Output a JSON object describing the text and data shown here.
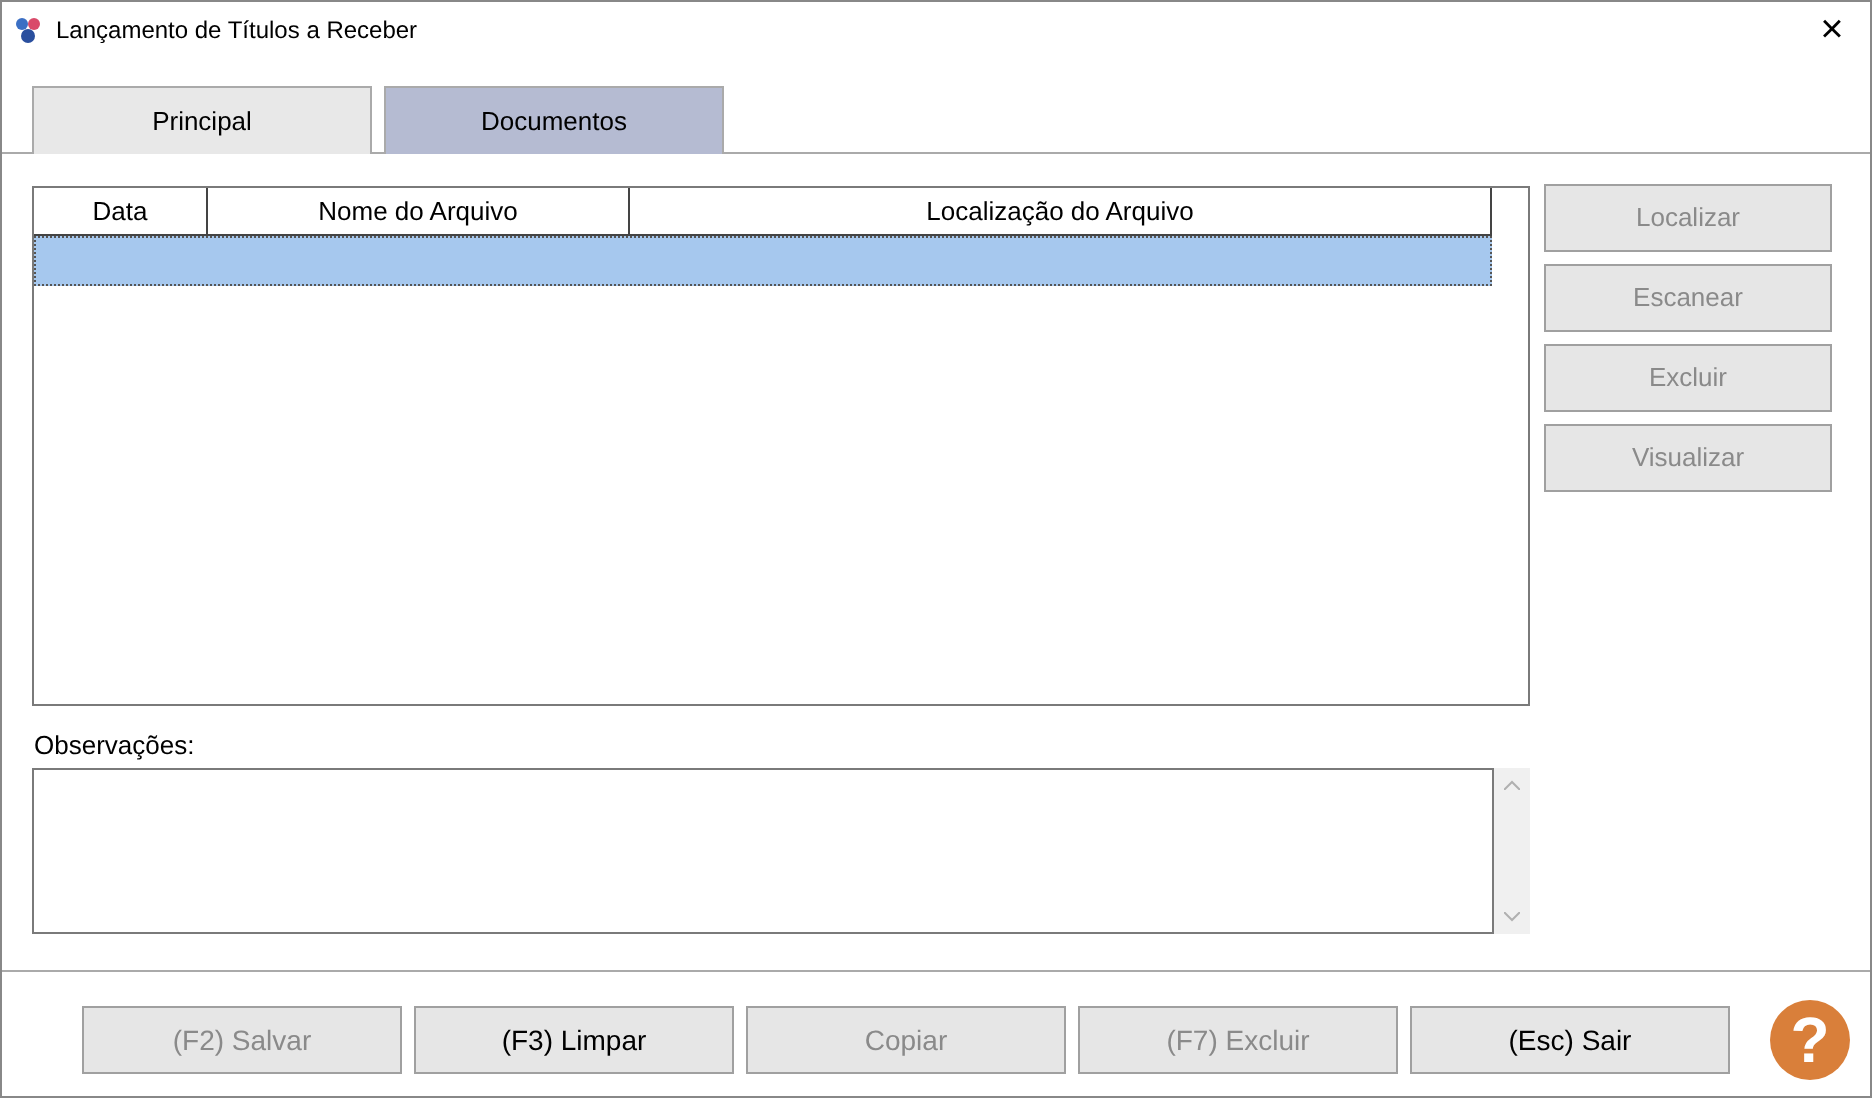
{
  "window": {
    "title": "Lançamento de Títulos a Receber",
    "close": "×"
  },
  "tabs": [
    {
      "label": "Principal",
      "selected": false
    },
    {
      "label": "Documentos",
      "selected": true
    }
  ],
  "table": {
    "columns": [
      "Data",
      "Nome do Arquivo",
      "Localização do Arquivo"
    ],
    "rows": [
      {
        "selected": true
      }
    ]
  },
  "side_buttons": [
    {
      "label": "Localizar",
      "disabled": true
    },
    {
      "label": "Escanear",
      "disabled": true
    },
    {
      "label": "Excluir",
      "disabled": true
    },
    {
      "label": "Visualizar",
      "disabled": true
    }
  ],
  "notes": {
    "label": "Observações:"
  },
  "footer_buttons": [
    {
      "label": "(F2) Salvar",
      "disabled": true
    },
    {
      "label": "(F3) Limpar",
      "disabled": false
    },
    {
      "label": "Copiar",
      "disabled": true
    },
    {
      "label": "(F7) Excluir",
      "disabled": true
    },
    {
      "label": "(Esc) Sair",
      "disabled": false
    }
  ],
  "help": {
    "label": "?"
  }
}
